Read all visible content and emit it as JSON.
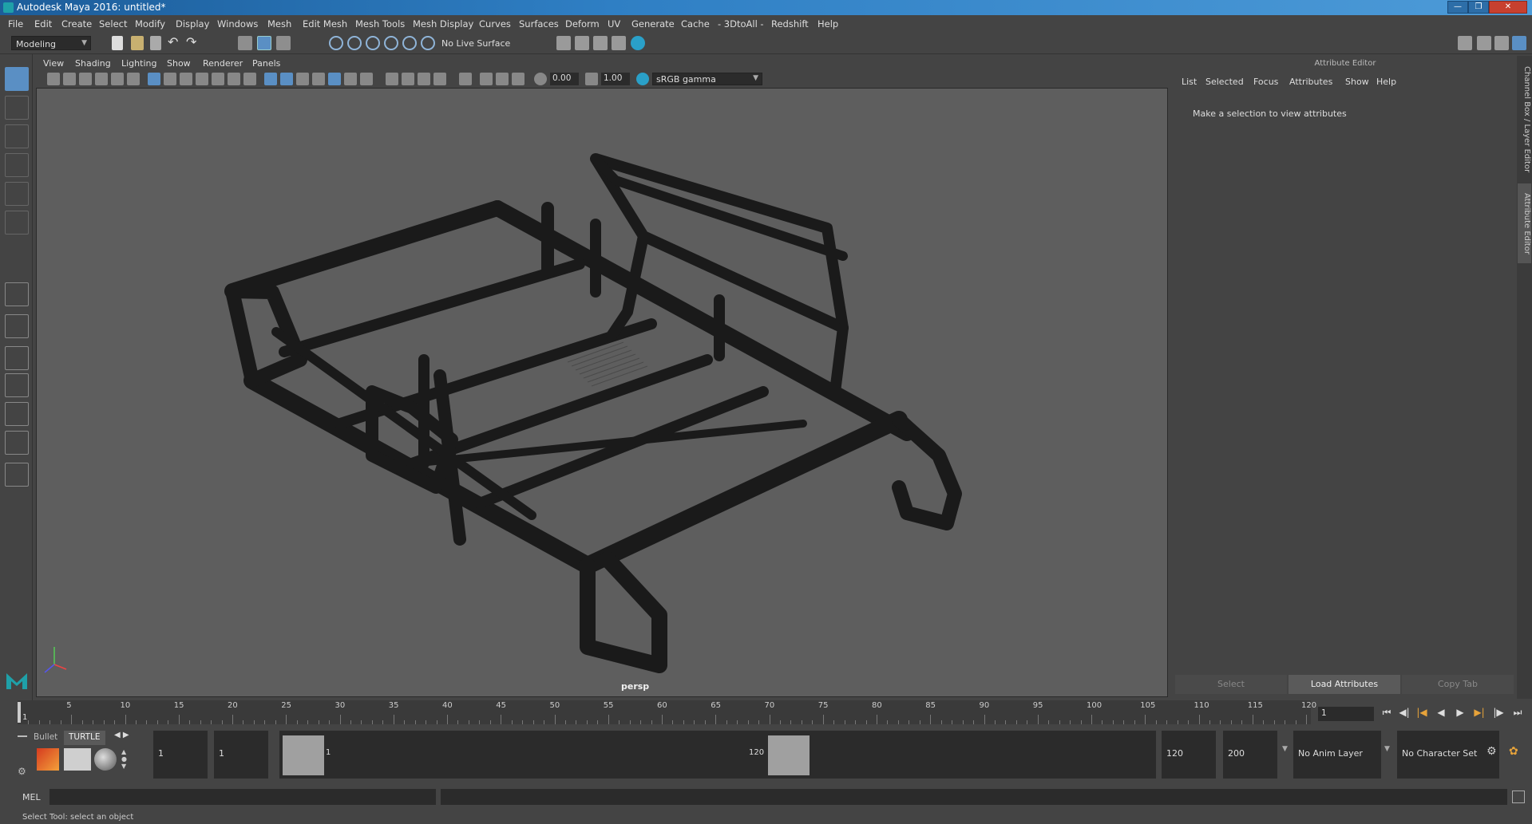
{
  "window": {
    "title": "Autodesk Maya 2016: untitled*"
  },
  "menubar": [
    "File",
    "Edit",
    "Create",
    "Select",
    "Modify",
    "Display",
    "Windows",
    "Mesh",
    "Edit Mesh",
    "Mesh Tools",
    "Mesh Display",
    "Curves",
    "Surfaces",
    "Deform",
    "UV",
    "Generate",
    "Cache",
    "- 3DtoAll -",
    "Redshift",
    "Help"
  ],
  "statusline": {
    "mode": "Modeling",
    "live_surface": "No Live Surface"
  },
  "panel": {
    "menu": [
      "View",
      "Shading",
      "Lighting",
      "Show",
      "Renderer",
      "Panels"
    ],
    "exposure": "0.00",
    "gamma": "1.00",
    "colorspace": "sRGB gamma",
    "camera_label": "persp"
  },
  "attribute_editor": {
    "title": "Attribute Editor",
    "menu": [
      "List",
      "Selected",
      "Focus",
      "Attributes",
      "Show",
      "Help"
    ],
    "message": "Make a selection to view attributes",
    "buttons": {
      "select": "Select",
      "load": "Load Attributes",
      "copy": "Copy Tab"
    },
    "side_tabs": [
      "Channel Box / Layer Editor",
      "Attribute Editor"
    ]
  },
  "timeslider": {
    "ticks": [
      "5",
      "10",
      "15",
      "20",
      "25",
      "30",
      "35",
      "40",
      "45",
      "50",
      "55",
      "60",
      "65",
      "70",
      "75",
      "80",
      "85",
      "90",
      "95",
      "100",
      "105",
      "110",
      "115",
      "120"
    ],
    "start_label": "1",
    "current_frame": "1"
  },
  "rangeslider": {
    "shelf_tabs": [
      "Bullet",
      "TURTLE"
    ],
    "start_time": "1",
    "playback_start": "1",
    "range_start_label": "1",
    "range_end_label": "120",
    "playback_end": "120",
    "end_time": "200",
    "anim_layer": "No Anim Layer",
    "character_set": "No Character Set"
  },
  "cmdline": {
    "language": "MEL"
  },
  "helpline": {
    "text": "Select Tool: select an object"
  },
  "colors": {
    "viewport_bg": "#5e5e5e",
    "mesh": "#1a1a1a",
    "title_blue": "#2f7fc4"
  }
}
